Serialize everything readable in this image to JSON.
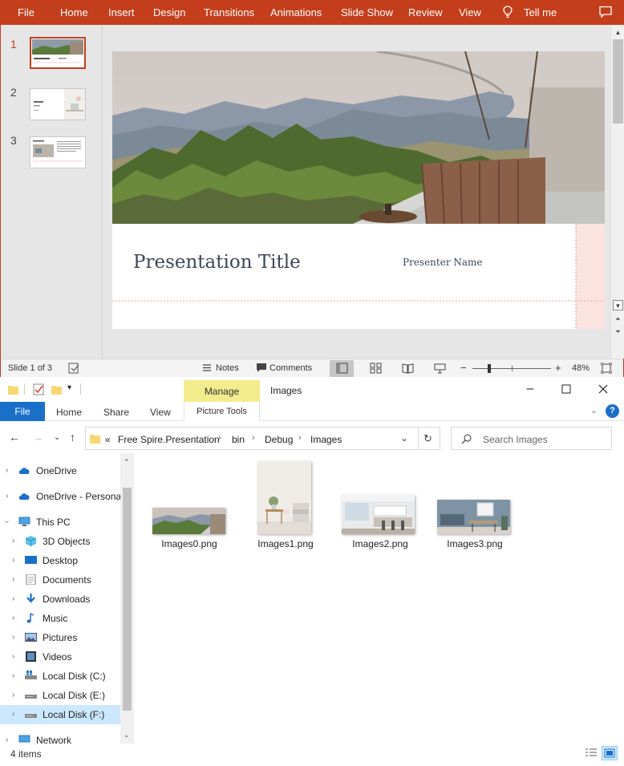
{
  "powerpoint": {
    "menu": [
      "File",
      "Home",
      "Insert",
      "Design",
      "Transitions",
      "Animations",
      "Slide Show",
      "Review",
      "View",
      "Tell me"
    ],
    "thumbnails": [
      {
        "number": "1"
      },
      {
        "number": "2"
      },
      {
        "number": "3"
      }
    ],
    "slide": {
      "title": "Presentation Title",
      "presenter": "Presenter Name"
    },
    "status": {
      "slide_info": "Slide 1 of 3",
      "notes": "Notes",
      "comments": "Comments",
      "zoom_minus": "−",
      "zoom_plus": "+",
      "zoom_percent": "48%",
      "zoom_level": 0.48
    },
    "accent_color": "#c43e1c"
  },
  "explorer": {
    "title": "Images",
    "manage_tab": "Manage",
    "picture_tools": "Picture Tools",
    "ribbon_tabs": [
      "File",
      "Home",
      "Share",
      "View"
    ],
    "breadcrumb": [
      "«",
      "Free Spire.Presentation",
      "bin",
      "Debug",
      "Images"
    ],
    "search_placeholder": "Search Images",
    "nav_tree": [
      {
        "label": "OneDrive",
        "icon": "cloud-icon"
      },
      {
        "label": "OneDrive - Personal",
        "icon": "cloud-icon"
      },
      {
        "label": "This PC",
        "icon": "computer-icon"
      },
      {
        "label": "3D Objects",
        "icon": "cube-icon"
      },
      {
        "label": "Desktop",
        "icon": "desktop-icon"
      },
      {
        "label": "Documents",
        "icon": "document-icon"
      },
      {
        "label": "Downloads",
        "icon": "download-icon"
      },
      {
        "label": "Music",
        "icon": "music-icon"
      },
      {
        "label": "Pictures",
        "icon": "pictures-icon"
      },
      {
        "label": "Videos",
        "icon": "video-icon"
      },
      {
        "label": "Local Disk (C:)",
        "icon": "drive-icon"
      },
      {
        "label": "Local Disk (E:)",
        "icon": "drive-icon"
      },
      {
        "label": "Local Disk (F:)",
        "icon": "drive-icon"
      },
      {
        "label": "Network",
        "icon": "network-icon"
      }
    ],
    "files": [
      {
        "name": "Images0.png"
      },
      {
        "name": "Images1.png"
      },
      {
        "name": "Images2.png"
      },
      {
        "name": "Images3.png"
      }
    ],
    "status": {
      "item_count": "4 items"
    },
    "accent_color": "#1a6fc9",
    "manage_color": "#f3ec8c"
  }
}
